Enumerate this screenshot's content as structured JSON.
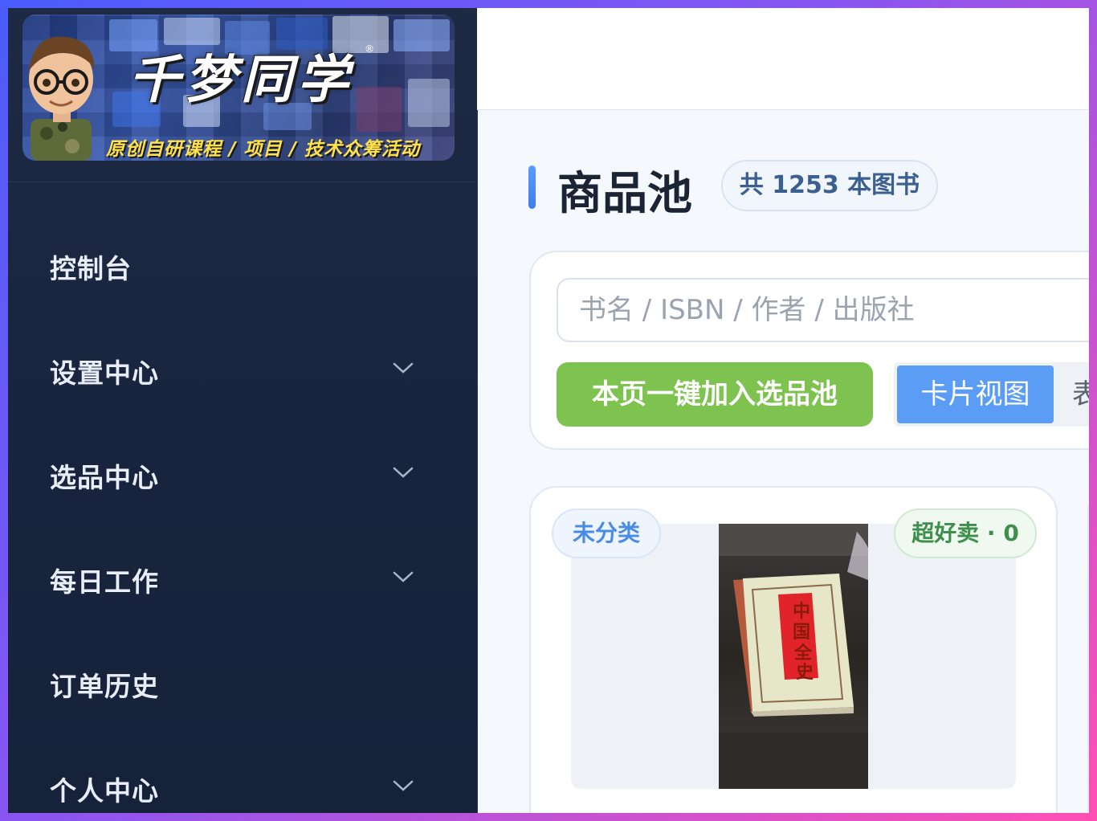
{
  "banner": {
    "title": "千梦同学",
    "registered_mark": "®",
    "subtitle": "原创自研课程 / 项目 / 技术众筹活动"
  },
  "sidebar": {
    "items": [
      {
        "label": "控制台",
        "expandable": false
      },
      {
        "label": "设置中心",
        "expandable": true
      },
      {
        "label": "选品中心",
        "expandable": true
      },
      {
        "label": "每日工作",
        "expandable": true
      },
      {
        "label": "订单历史",
        "expandable": false
      },
      {
        "label": "个人中心",
        "expandable": true
      }
    ]
  },
  "header": {
    "title": "商品池",
    "count_badge": "共 1253 本图书"
  },
  "toolbar": {
    "search_placeholder": "书名 / ISBN / 作者 / 出版社",
    "add_page_label": "本页一键加入选品池",
    "view_card_label": "卡片视图",
    "view_table_label": "表格视图",
    "active_view": "card"
  },
  "products": [
    {
      "category_tag": "未分类",
      "sales_tag": "超好卖 · 0"
    }
  ],
  "colors": {
    "accent_blue": "#5b9cf5",
    "add_button_green": "#7ec250",
    "sidebar_bg": "#1e2a44"
  }
}
